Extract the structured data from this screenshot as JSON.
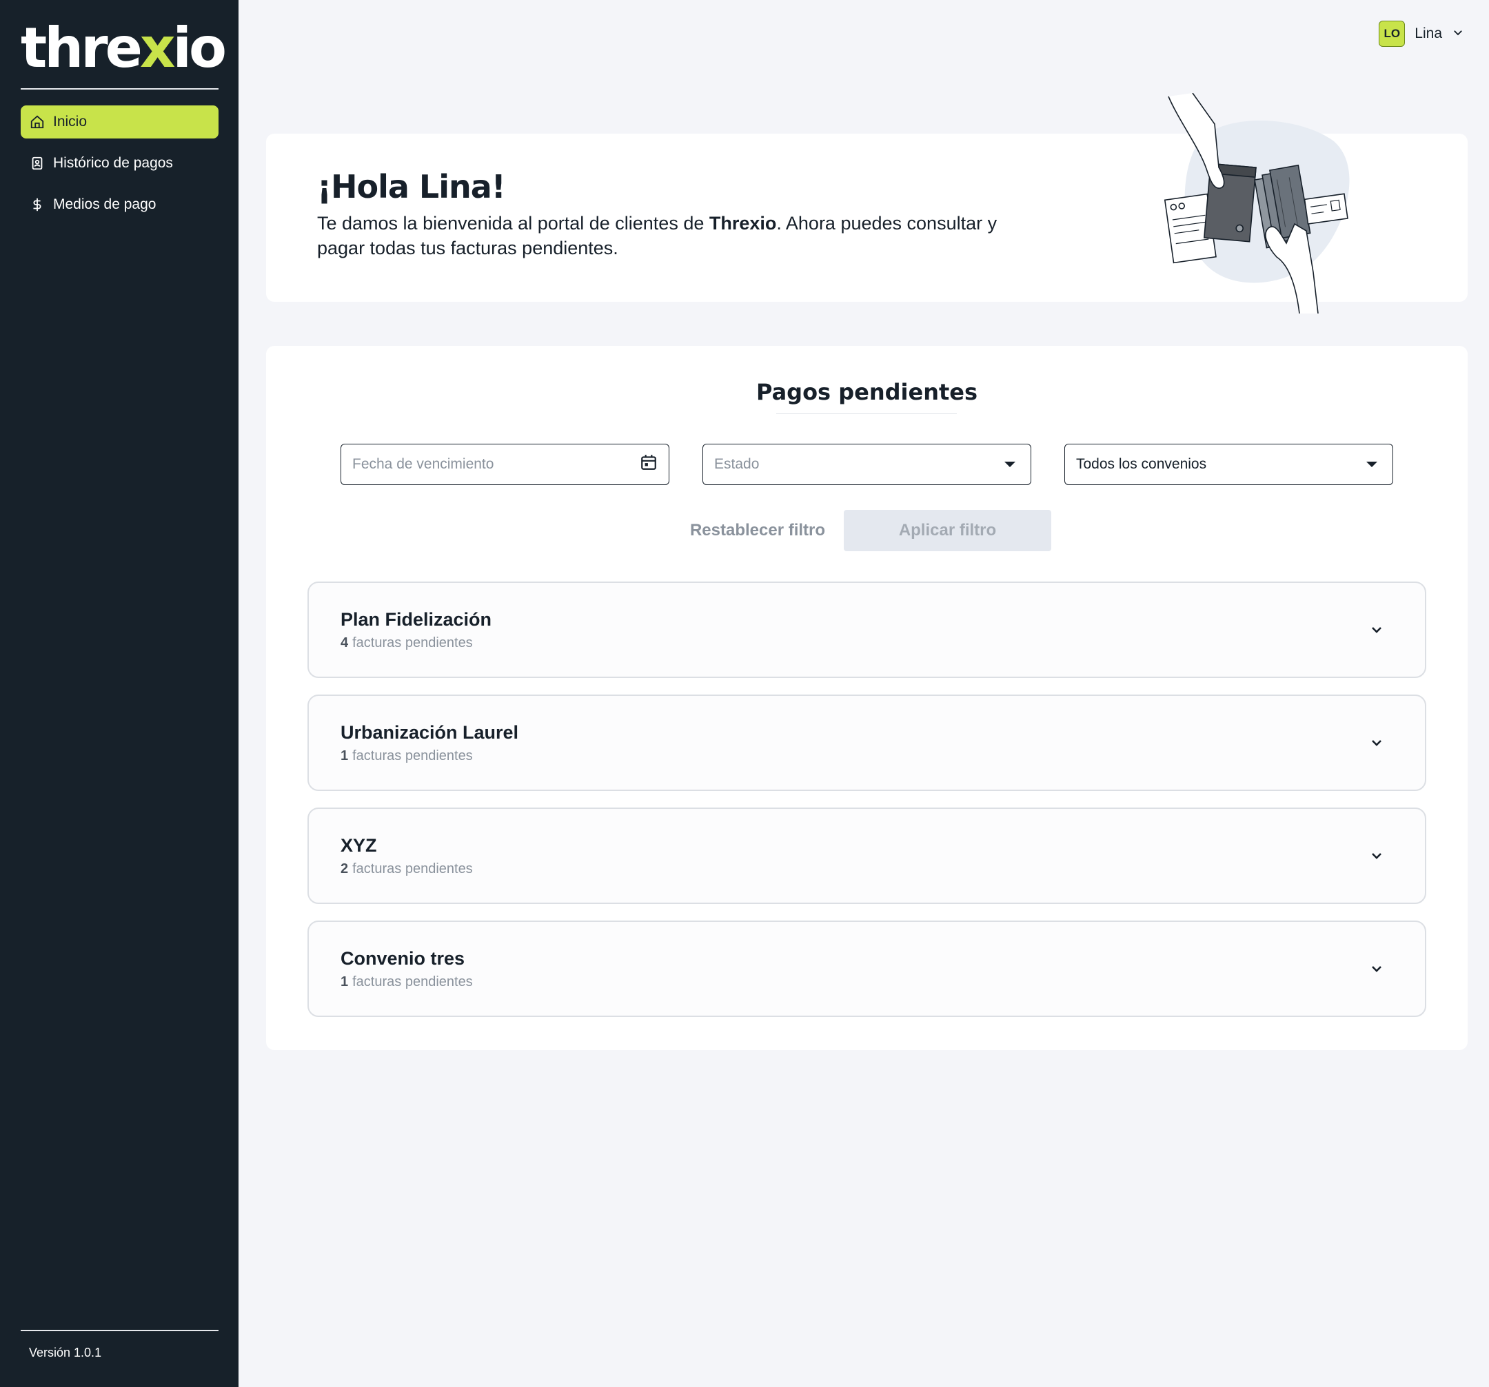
{
  "brand": {
    "logo_pre": "thre",
    "logo_x": "x",
    "logo_post": "io",
    "accent": "#c8e34a",
    "sidebar_bg": "#17212a"
  },
  "sidebar": {
    "items": [
      {
        "label": "Inicio",
        "icon": "home-icon",
        "active": true
      },
      {
        "label": "Histórico de pagos",
        "icon": "contact-book-icon",
        "active": false
      },
      {
        "label": "Medios de pago",
        "icon": "dollar-icon",
        "active": false
      }
    ],
    "version": "Versión 1.0.1"
  },
  "header": {
    "user_initials": "LO",
    "user_name": "Lina"
  },
  "welcome": {
    "title": "¡Hola Lina!",
    "text_before": "Te damos la bienvenida al portal de clientes de ",
    "text_brand": "Threxio",
    "text_after": ". Ahora puedes consultar y pagar todas tus facturas pendientes."
  },
  "pending": {
    "title": "Pagos pendientes",
    "filters": {
      "date_placeholder": "Fecha de vencimiento",
      "status_placeholder": "Estado",
      "agreement_value": "Todos los convenios"
    },
    "reset_label": "Restablecer filtro",
    "apply_label": "Aplicar filtro",
    "agreements": [
      {
        "name": "Plan Fidelización",
        "count": "4",
        "suffix": "facturas pendientes"
      },
      {
        "name": "Urbanización Laurel",
        "count": "1",
        "suffix": "facturas pendientes"
      },
      {
        "name": "XYZ",
        "count": "2",
        "suffix": "facturas pendientes"
      },
      {
        "name": "Convenio tres",
        "count": "1",
        "suffix": "facturas pendientes"
      }
    ]
  }
}
